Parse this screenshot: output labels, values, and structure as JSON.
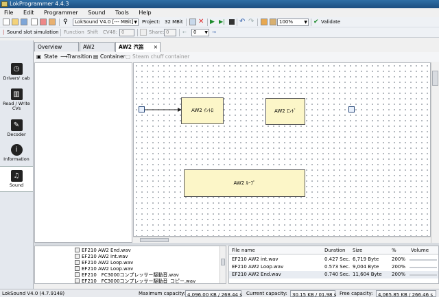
{
  "window": {
    "title": "LokProgrammer 4.4.3"
  },
  "menu": [
    "File",
    "Edit",
    "Programmer",
    "Sound",
    "Tools",
    "Help"
  ],
  "toolbar": {
    "decoder_select": "LokSound V4.0 [--- MBit]",
    "project_label": "Project:",
    "project_value": "32 MBit",
    "volume_value": "100%",
    "validate_label": "Validate"
  },
  "toolbar2": {
    "sound_slot_label": "Sound slot simulation",
    "function_label": "Function",
    "shift_label": "Shift",
    "cv48_label": "CV48:",
    "cv48_value": "0",
    "share_label": "Share:",
    "share_value": "0",
    "nav_value": "0"
  },
  "sidebar": {
    "items": [
      {
        "label": "Drivers' cab",
        "icon": "drivers-cab-icon"
      },
      {
        "label": "Read / Write CVs",
        "icon": "read-write-cvs-icon"
      },
      {
        "label": "Decoder",
        "icon": "wrench-icon"
      },
      {
        "label": "Information",
        "icon": "information-icon"
      },
      {
        "label": "Sound",
        "icon": "sound-notes-icon"
      }
    ],
    "selected": "Sound"
  },
  "tabs": [
    {
      "label": "Overview"
    },
    {
      "label": "AW2"
    },
    {
      "label": "AW2 汽笛",
      "active": true,
      "close": "×"
    }
  ],
  "subtoolbar": {
    "state_label": "State",
    "transition_label": "Transition",
    "container_label": "Container",
    "steam_label": "Steam chuff container"
  },
  "canvas": {
    "states": [
      {
        "label": "AW2 ｲﾝﾄﾛ"
      },
      {
        "label": "AW2 ｴﾝﾄﾞ"
      },
      {
        "label": "AW2 ﾙｰﾌﾟ"
      }
    ]
  },
  "file_list": [
    "EF210 AW2 End.wav",
    "EF210 AW2 int.wav",
    "EF210 AW2 Loop.wav",
    "EF210 AW2 Loop.wav",
    "EF210　FC3000コンプレッサー駆動音.wav",
    "EF210　FC3000コンプレッサー駆動音_コピー.wav"
  ],
  "sound_table": {
    "headers": [
      "File name",
      "Duration",
      "Size",
      "%",
      "Volume"
    ],
    "rows": [
      {
        "name": "EF210 AW2 int.wav",
        "duration": "0.427 Sec.",
        "size": "6,719 Byte",
        "pct": "200%"
      },
      {
        "name": "EF210 AW2 Loop.wav",
        "duration": "0.573 Sec.",
        "size": "9,004 Byte",
        "pct": "200%"
      },
      {
        "name": "EF210 AW2 End.wav",
        "duration": "0.740 Sec.",
        "size": "11,604 Byte",
        "pct": "200%"
      }
    ]
  },
  "status": {
    "version": "LokSound V4.0 (4.7.9148)",
    "max_label": "Maximum capacity:",
    "max_value": "4,096.00 KB / 268.44 s",
    "cur_label": "Current capacity:",
    "cur_value": "30.15 KB / 01.98 s",
    "free_label": "Free capacity:",
    "free_value": "4,065.85 KB / 266.46 s"
  }
}
